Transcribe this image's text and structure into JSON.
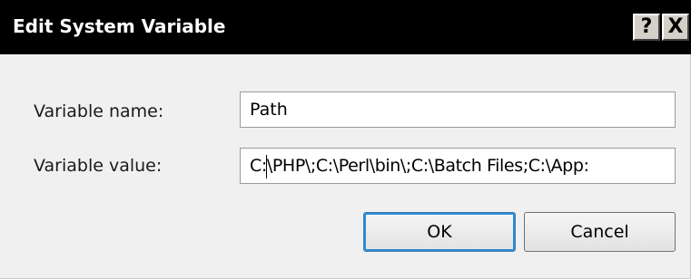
{
  "dialog": {
    "title": "Edit System Variable",
    "help_glyph": "?",
    "close_glyph": "X"
  },
  "fields": {
    "name_label": "Variable name:",
    "name_value": "Path",
    "value_label": "Variable value:",
    "value_value": "C:\\PHP\\;C:\\Perl\\bin\\;C:\\Batch Files;C:\\App:"
  },
  "buttons": {
    "ok_label": "OK",
    "cancel_label": "Cancel"
  },
  "colors": {
    "titlebar_bg": "#000000",
    "titlebar_text": "#ffffff",
    "dialog_bg": "#f0f0f0",
    "default_button_focus": "#2e8bd6"
  },
  "icons": {
    "help": "help-icon",
    "close": "close-icon"
  }
}
